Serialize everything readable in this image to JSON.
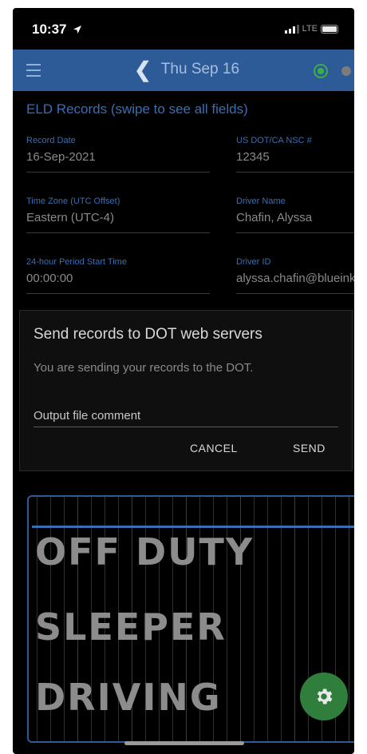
{
  "status_bar": {
    "time": "10:37",
    "network": "LTE"
  },
  "app_bar": {
    "date_title": "Thu Sep 16"
  },
  "eld": {
    "title": "ELD Records (swipe to see all fields)",
    "fields": [
      {
        "label": "Record Date",
        "value": "16-Sep-2021"
      },
      {
        "label": "US DOT/CA NSC #",
        "value": "12345"
      },
      {
        "label": "Time Zone (UTC Offset)",
        "value": "Eastern (UTC-4)"
      },
      {
        "label": "Driver Name",
        "value": "Chafin, Alyssa"
      },
      {
        "label": "24-hour Period Start Time",
        "value": "00:00:00"
      },
      {
        "label": "Driver ID",
        "value": "alyssa.chafin@blueink"
      }
    ]
  },
  "dialog": {
    "title": "Send records to DOT web servers",
    "message": "You are sending your records to the DOT.",
    "comment_placeholder": "Output file comment",
    "comment_value": "",
    "cancel_label": "CANCEL",
    "send_label": "SEND"
  },
  "chart": {
    "labels": [
      "OFF DUTY",
      "SLEEPER",
      "DRIVING"
    ]
  },
  "colors": {
    "app_bar": "#2d5b98",
    "accent_text": "#3b6eb0",
    "fab": "#2f7e3b",
    "location_indicator": "#3cae4a"
  },
  "icons": {
    "menu": "hamburger-menu-icon",
    "back": "chevron-left-icon",
    "location": "location-target-icon",
    "settings": "gear-icon"
  }
}
